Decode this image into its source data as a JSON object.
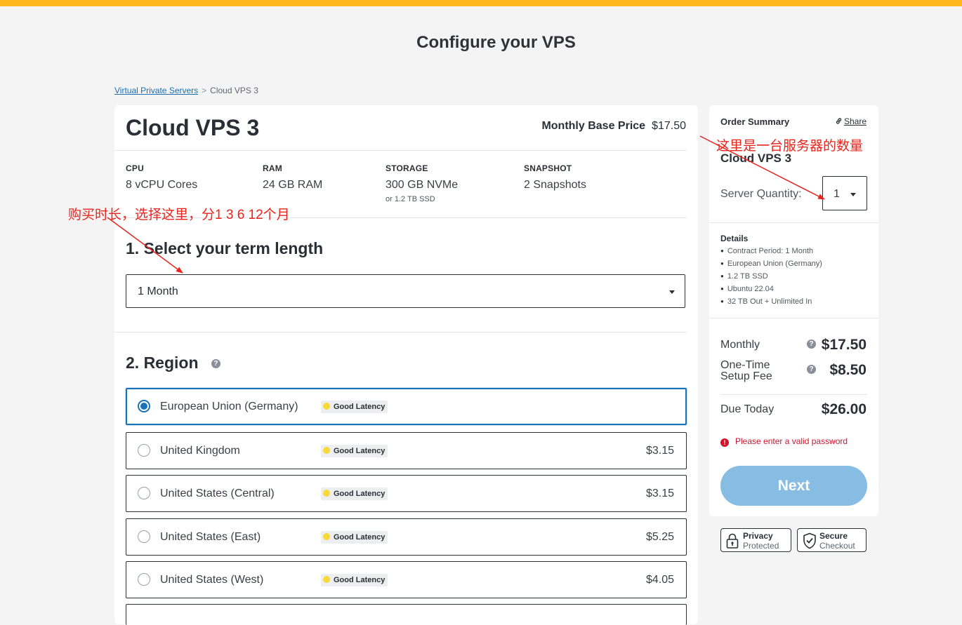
{
  "page": {
    "title": "Configure your VPS"
  },
  "breadcrumb": {
    "link": "Virtual Private Servers",
    "separator": ">",
    "current": "Cloud VPS 3"
  },
  "product": {
    "name": "Cloud VPS 3",
    "base_price_label": "Monthly Base Price",
    "base_price": "$17.50",
    "specs": [
      {
        "label": "CPU",
        "value": "8 vCPU Cores",
        "sub": ""
      },
      {
        "label": "RAM",
        "value": "24 GB RAM",
        "sub": ""
      },
      {
        "label": "STORAGE",
        "value": "300 GB NVMe",
        "sub": "or 1.2 TB SSD"
      },
      {
        "label": "SNAPSHOT",
        "value": "2 Snapshots",
        "sub": ""
      }
    ]
  },
  "term": {
    "title": "1. Select your term length",
    "selected": "1 Month"
  },
  "region": {
    "title": "2. Region",
    "options": [
      {
        "name": "European Union (Germany)",
        "badge": "Good Latency",
        "price": "",
        "selected": true
      },
      {
        "name": "United Kingdom",
        "badge": "Good Latency",
        "price": "$3.15",
        "selected": false
      },
      {
        "name": "United States (Central)",
        "badge": "Good Latency",
        "price": "$3.15",
        "selected": false
      },
      {
        "name": "United States (East)",
        "badge": "Good Latency",
        "price": "$5.25",
        "selected": false
      },
      {
        "name": "United States (West)",
        "badge": "Good Latency",
        "price": "$4.05",
        "selected": false
      }
    ]
  },
  "summary": {
    "title": "Order Summary",
    "share": "Share",
    "product": "Cloud VPS 3",
    "quantity_label": "Server Quantity:",
    "quantity": "1",
    "details_title": "Details",
    "details": [
      "Contract Period: 1 Month",
      "European Union (Germany)",
      "1.2 TB SSD",
      "Ubuntu 22.04",
      "32 TB Out + Unlimited In"
    ],
    "monthly_label": "Monthly",
    "monthly_value": "$17.50",
    "setup_label_1": "One-Time",
    "setup_label_2": "Setup Fee",
    "setup_value": "$8.50",
    "due_label": "Due Today",
    "due_value": "$26.00",
    "error": "Please enter a valid password",
    "next": "Next"
  },
  "trust": {
    "privacy_1": "Privacy",
    "privacy_2": "Protected",
    "secure_1": "Secure",
    "secure_2": "Checkout"
  },
  "annotations": {
    "quantity_note": "这里是一台服务器的数量",
    "term_note": "购买时长，选择这里，分1 3 6 12个月"
  },
  "colors": {
    "accent_bar": "#ffb81c",
    "primary": "#1a72b8",
    "next_button": "#88bde3",
    "error": "#d0142c",
    "annotation": "#e8241c"
  }
}
